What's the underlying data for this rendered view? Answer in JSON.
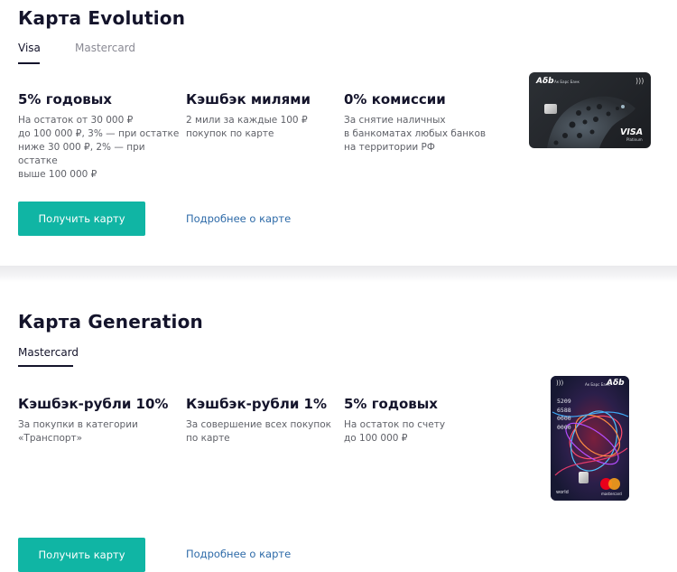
{
  "evolution": {
    "title": "Карта Evolution",
    "tabs": [
      "Visa",
      "Mastercard"
    ],
    "features": [
      {
        "title": "5% годовых",
        "desc": "На остаток от 30 000 ₽\nдо 100 000 ₽, 3% — при остатке\nниже 30 000 ₽, 2% — при остатке\nвыше 100 000 ₽"
      },
      {
        "title": "Кэшбэк милями",
        "desc": "2 мили за каждые 100 ₽\nпокупок по карте"
      },
      {
        "title": "0% комиссии",
        "desc": "За снятие наличных\nв банкоматах любых банков\nна территории РФ"
      }
    ],
    "get_card": "Получить карту",
    "more": "Подробнее о карте",
    "card": {
      "brand": "VISA",
      "tier": "Platinum",
      "bank_logo": "Ак Барс Банк"
    }
  },
  "generation": {
    "title": "Карта Generation",
    "tabs": [
      "Mastercard"
    ],
    "features": [
      {
        "title": "Кэшбэк-рубли 10%",
        "desc": "За покупки в категории\n«Транспорт»"
      },
      {
        "title": "Кэшбэк-рубли 1%",
        "desc": "За совершение всех покупок\nпо карте"
      },
      {
        "title": "5% годовых",
        "desc": "На остаток по счету\nдо 100 000 ₽"
      }
    ],
    "get_card": "Получить карту",
    "more": "Подробнее о карте",
    "card": {
      "number": "5209\n6588\n0000\n0000",
      "tier": "world",
      "brand": "mastercard",
      "bank_logo": "Ак Барс Банк"
    }
  },
  "colors": {
    "accent": "#10b5a4",
    "link": "#2d6aa8"
  }
}
